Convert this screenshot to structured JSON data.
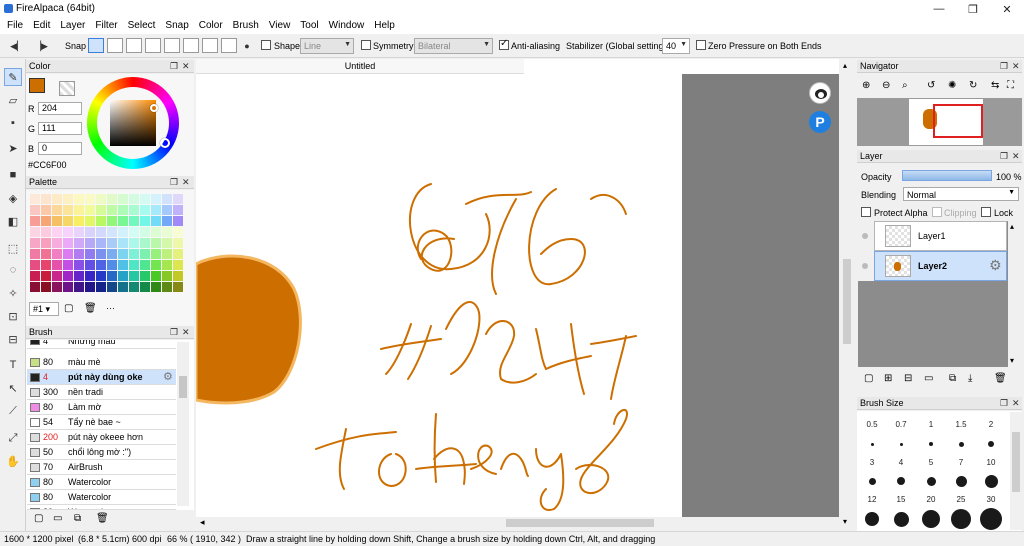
{
  "window": {
    "title": "FireAlpaca (64bit)",
    "minimize_glyph": "—",
    "restore_glyph": "❐",
    "close_glyph": "✕"
  },
  "menubar": [
    "File",
    "Edit",
    "Layer",
    "Filter",
    "Select",
    "Snap",
    "Color",
    "Brush",
    "View",
    "Tool",
    "Window",
    "Help"
  ],
  "toolbar": {
    "snap_label": "Snap",
    "shape_label": "Shape",
    "shape_value": "Line",
    "symmetry_label": "Symmetry",
    "symmetry_value": "Bilateral",
    "antialias_label": "Anti-aliasing",
    "stabilizer_label": "Stabilizer (Global settings)",
    "stabilizer_value": "40",
    "zero_pressure_label": "Zero Pressure on Both Ends"
  },
  "color_panel": {
    "title": "Color",
    "r_label": "R",
    "r_value": "204",
    "g_label": "G",
    "g_value": "111",
    "b_label": "B",
    "b_value": "0",
    "hex": "#CC6F00",
    "current_color": "#CC6F00"
  },
  "palette_panel": {
    "title": "Palette",
    "selector": "#1",
    "more": "···",
    "colors": [
      "#fde9d9",
      "#fde4cf",
      "#fdebc8",
      "#fdf0c3",
      "#fdf7c2",
      "#fafbc4",
      "#eefbc4",
      "#e0fbc8",
      "#d7fbd0",
      "#d3fbe2",
      "#d3fbf2",
      "#d3f2fb",
      "#d3e2fb",
      "#e0d8fb",
      "#fbc7c2",
      "#fbc9a8",
      "#fbd79a",
      "#fbe59a",
      "#fbf39a",
      "#f1fb9a",
      "#d8fb9a",
      "#bffba5",
      "#acfbb6",
      "#a6fbd1",
      "#a6fbee",
      "#a6e9fb",
      "#a6c9fb",
      "#c1b1fb",
      "#f79c97",
      "#f7a575",
      "#f7bf63",
      "#f7d763",
      "#f7ee63",
      "#e2f763",
      "#b9f763",
      "#91f779",
      "#79f794",
      "#72f7bf",
      "#72f7e7",
      "#72dbf7",
      "#72a8f7",
      "#a189f7",
      "#fcd5e5",
      "#fccbe0",
      "#fcd3f0",
      "#f6d3fc",
      "#e7d3fc",
      "#d9d3fc",
      "#d3d9fc",
      "#d3e5fc",
      "#d3f1fc",
      "#d3fcf5",
      "#d3fce6",
      "#dcfcd3",
      "#eafcd3",
      "#f7fcd3",
      "#f8a6c6",
      "#f89fbd",
      "#f8acdd",
      "#eba9f8",
      "#cfa9f8",
      "#b6a9f8",
      "#a9b6f8",
      "#a9cbf8",
      "#a9e4f8",
      "#a9f8e9",
      "#a9f8cc",
      "#b9f8a9",
      "#d4f8a9",
      "#eff8a9",
      "#f07aa4",
      "#f07193",
      "#f07fc4",
      "#db7cf0",
      "#b07cf0",
      "#907cf0",
      "#7c90f0",
      "#7cacf0",
      "#7cd3f0",
      "#7cf0d8",
      "#7cf0ae",
      "#96f07c",
      "#bdf07c",
      "#e6f07c",
      "#e64d80",
      "#e6446c",
      "#e652aa",
      "#c44fe6",
      "#8a4fe6",
      "#634fe6",
      "#4f63e6",
      "#4f8de6",
      "#4fc1e6",
      "#4fe6c6",
      "#4fe691",
      "#72e64f",
      "#a6e64f",
      "#dce64f",
      "#c81e52",
      "#c81e3b",
      "#c8268a",
      "#a026c8",
      "#6426c8",
      "#3a26c8",
      "#263ac8",
      "#2668c8",
      "#26a2c8",
      "#26c8a4",
      "#26c86a",
      "#4ac826",
      "#87c826",
      "#c2c826",
      "#8a0f34",
      "#8a0f22",
      "#8a145e",
      "#6e148a",
      "#42148a",
      "#22148a",
      "#14228a",
      "#14468a",
      "#14728a",
      "#148a72",
      "#148a48",
      "#2e8a14",
      "#5c8a14",
      "#868a14"
    ]
  },
  "brush_panel": {
    "title": "Brush",
    "items": [
      {
        "size": "4",
        "name": "Những màu",
        "color": "#222222"
      },
      {
        "size": "80",
        "name": "màu mè",
        "color": "#c7e085"
      },
      {
        "size": "4",
        "name": "pút này dùng oke",
        "color": "#222222"
      },
      {
        "size": "300",
        "name": "nền tradi",
        "color": "#dddddd"
      },
      {
        "size": "80",
        "name": "Làm mờ",
        "color": "#f08be6"
      },
      {
        "size": "54",
        "name": "Tẩy nè bae ~",
        "color": "#ffffff"
      },
      {
        "size": "200",
        "name": "pút này okeee hơn",
        "color": "#dddddd"
      },
      {
        "size": "50",
        "name": "chổi lông mờ :\")",
        "color": "#dddddd"
      },
      {
        "size": "70",
        "name": "AirBrush",
        "color": "#dddddd"
      },
      {
        "size": "80",
        "name": "Watercolor",
        "color": "#8fd0f0"
      },
      {
        "size": "80",
        "name": "Watercolor",
        "color": "#8fd0f0"
      },
      {
        "size": "80",
        "name": "Watercolor",
        "color": "#8fd0f0"
      }
    ],
    "selected_index": 2
  },
  "canvas": {
    "doc_tab": "Untitled",
    "stroke_color": "#CC6F00",
    "fill_color": "#CC6F00",
    "ha_label": "HA",
    "fb_label": "f"
  },
  "navigator_panel": {
    "title": "Navigator",
    "toolbar_glyphs": [
      "⊕",
      "⊖",
      "⌕",
      "↺",
      "✺",
      "↻",
      "⇆",
      "⛶"
    ]
  },
  "layer_panel": {
    "title": "Layer",
    "opacity_label": "Opacity",
    "opacity_value": "100 %",
    "opacity_fraction": 1.0,
    "blending_label": "Blending",
    "blending_value": "Normal",
    "protect_alpha_label": "Protect Alpha",
    "clipping_label": "Clipping",
    "lock_label": "Lock",
    "layers": [
      {
        "name": "Layer1",
        "selected": false
      },
      {
        "name": "Layer2",
        "selected": true
      }
    ]
  },
  "brush_size_panel": {
    "title": "Brush Size",
    "sizes": [
      "0.5",
      "0.7",
      "1",
      "1.5",
      "2",
      "3",
      "4",
      "5",
      "7",
      "10",
      "12",
      "15",
      "20",
      "25",
      "30"
    ]
  },
  "statusbar": {
    "dimensions": "1600 * 1200 pixel",
    "physical": "(6.8 * 5.1cm)",
    "dpi": "600 dpi",
    "zoom": "66 %",
    "coords": "( 1910, 342 )",
    "hint": "Draw a straight line by holding down Shift, Change a brush size by holding down Ctrl, Alt, and dragging"
  }
}
